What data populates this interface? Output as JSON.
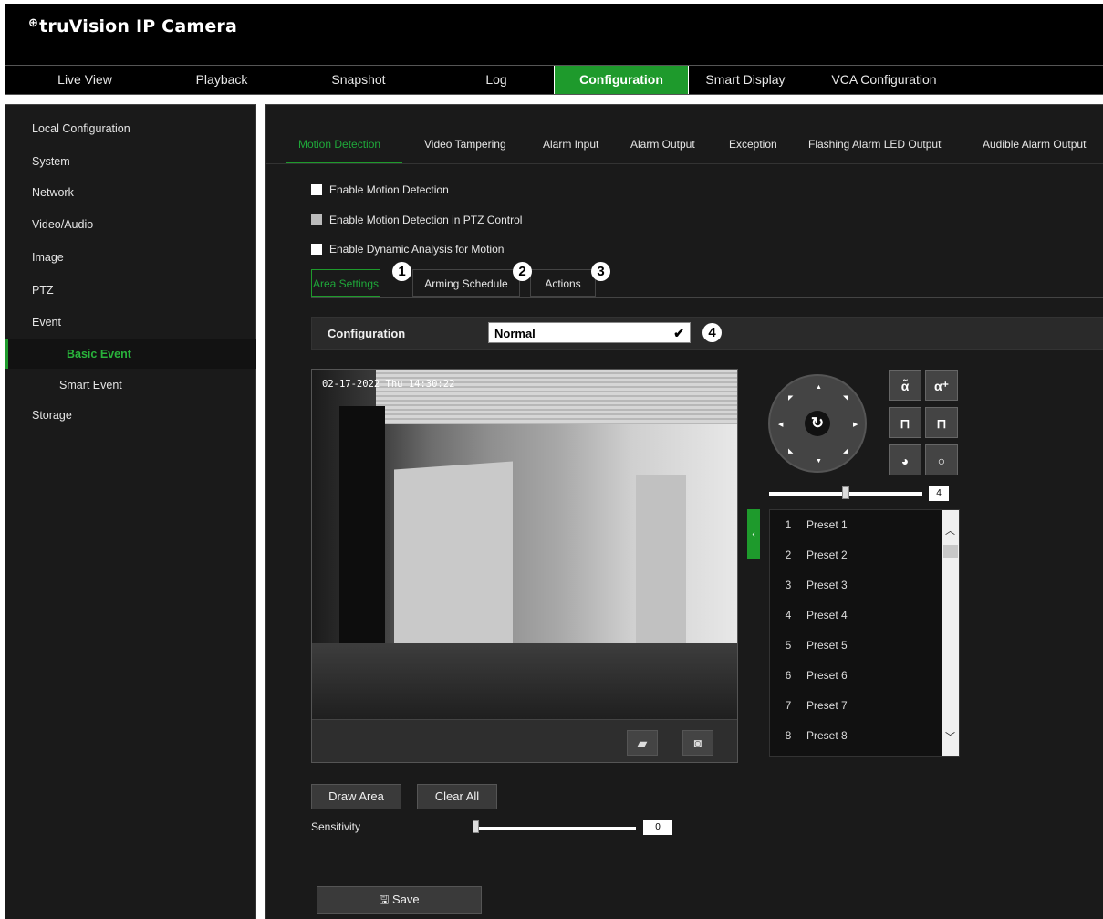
{
  "app": {
    "logo_glyph": "⊕",
    "logo_text": "truVision IP Camera"
  },
  "nav": [
    {
      "label": "Live View"
    },
    {
      "label": "Playback"
    },
    {
      "label": "Snapshot"
    },
    {
      "label": "Log"
    },
    {
      "label": "Configuration",
      "active": true
    },
    {
      "label": "Smart Display"
    },
    {
      "label": "VCA Configuration"
    }
  ],
  "sidebar": [
    {
      "label": "Local Configuration"
    },
    {
      "label": "System"
    },
    {
      "label": "Network"
    },
    {
      "label": "Video/Audio"
    },
    {
      "label": "Image"
    },
    {
      "label": "PTZ"
    },
    {
      "label": "Event"
    },
    {
      "label": "Basic Event",
      "active": true
    },
    {
      "label": "Smart Event"
    },
    {
      "label": "Storage"
    }
  ],
  "subtabs": [
    {
      "label": "Motion Detection",
      "active": true
    },
    {
      "label": "Video Tampering"
    },
    {
      "label": "Alarm Input"
    },
    {
      "label": "Alarm Output"
    },
    {
      "label": "Exception"
    },
    {
      "label": "Flashing Alarm LED Output"
    },
    {
      "label": "Audible Alarm Output"
    }
  ],
  "checkboxes": [
    {
      "label": "Enable Motion Detection",
      "checked": false
    },
    {
      "label": "Enable Motion Detection in PTZ Control",
      "checked": false,
      "disabled": true
    },
    {
      "label": "Enable Dynamic Analysis for Motion",
      "checked": false
    }
  ],
  "inner_tabs": [
    {
      "label": "Area Settings",
      "active": true
    },
    {
      "label": "Arming Schedule"
    },
    {
      "label": "Actions"
    }
  ],
  "callouts": [
    "1",
    "2",
    "3",
    "4"
  ],
  "config": {
    "label": "Configuration",
    "value": "Normal"
  },
  "video": {
    "timestamp": "02-17-2022 Thu 14:30:22"
  },
  "ptz": {
    "zoom_out": "α̃",
    "zoom_in": "α⁺",
    "focus_near": "⊓",
    "focus_far": "⊓",
    "iris_close": "◕",
    "iris_open": "○",
    "speed_value": "4",
    "speed_fraction": 0.5
  },
  "presets": [
    {
      "num": "1",
      "name": "Preset 1"
    },
    {
      "num": "2",
      "name": "Preset 2"
    },
    {
      "num": "3",
      "name": "Preset 3"
    },
    {
      "num": "4",
      "name": "Preset 4"
    },
    {
      "num": "5",
      "name": "Preset 5"
    },
    {
      "num": "6",
      "name": "Preset 6"
    },
    {
      "num": "7",
      "name": "Preset 7"
    },
    {
      "num": "8",
      "name": "Preset 8"
    }
  ],
  "buttons": {
    "draw_area": "Draw Area",
    "clear_all": "Clear All",
    "save": "Save"
  },
  "sensitivity": {
    "label": "Sensitivity",
    "value": "0"
  },
  "colors": {
    "accent": "#1e9a2c",
    "bg": "#1a1a1a"
  }
}
